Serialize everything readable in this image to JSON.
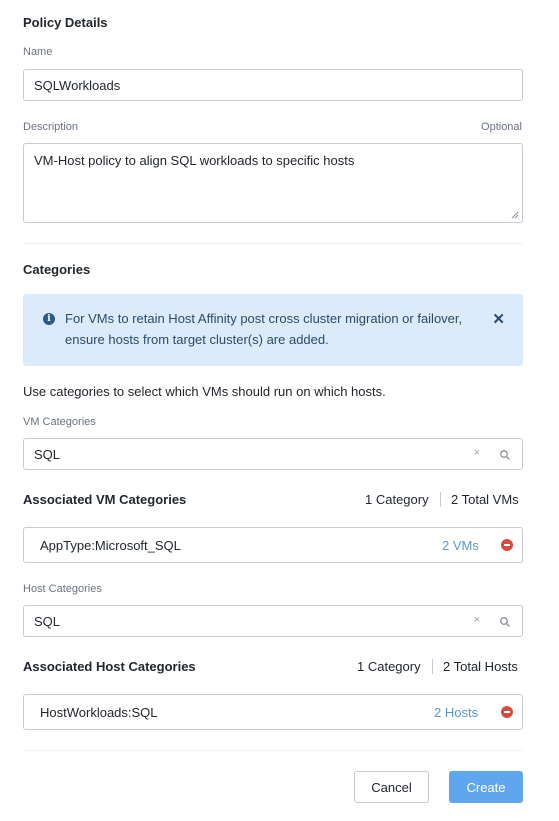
{
  "policy_details": {
    "heading": "Policy Details",
    "name_label": "Name",
    "name_value": "SQLWorkloads",
    "description_label": "Description",
    "optional_label": "Optional",
    "description_value": "VM-Host policy to align SQL workloads to specific hosts"
  },
  "categories": {
    "heading": "Categories",
    "info_message": "For VMs to retain Host Affinity post cross cluster migration or failover, ensure hosts from target cluster(s) are added.",
    "help_text": "Use categories to select which VMs should run on which hosts.",
    "vm_categories_label": "VM Categories",
    "vm_search_value": "SQL",
    "clear_symbol": "×",
    "associated_vm": {
      "title": "Associated VM Categories",
      "category_count": "1 Category",
      "total": "2 Total VMs",
      "items": [
        {
          "name": "AppType:Microsoft_SQL",
          "link": "2 VMs"
        }
      ]
    },
    "host_categories_label": "Host Categories",
    "host_search_value": "SQL",
    "associated_host": {
      "title": "Associated Host Categories",
      "category_count": "1 Category",
      "total": "2 Total Hosts",
      "items": [
        {
          "name": "HostWorkloads:SQL",
          "link": "2 Hosts"
        }
      ]
    }
  },
  "footer": {
    "cancel_label": "Cancel",
    "create_label": "Create"
  },
  "colors": {
    "info_bg": "#dcebfb",
    "link": "#5a97d6",
    "primary_button": "#5fa6ef",
    "remove": "#d64c40"
  },
  "icons": {
    "info": "info-icon",
    "close": "close-icon",
    "clear": "clear-icon",
    "search": "search-icon",
    "remove": "remove-icon"
  }
}
